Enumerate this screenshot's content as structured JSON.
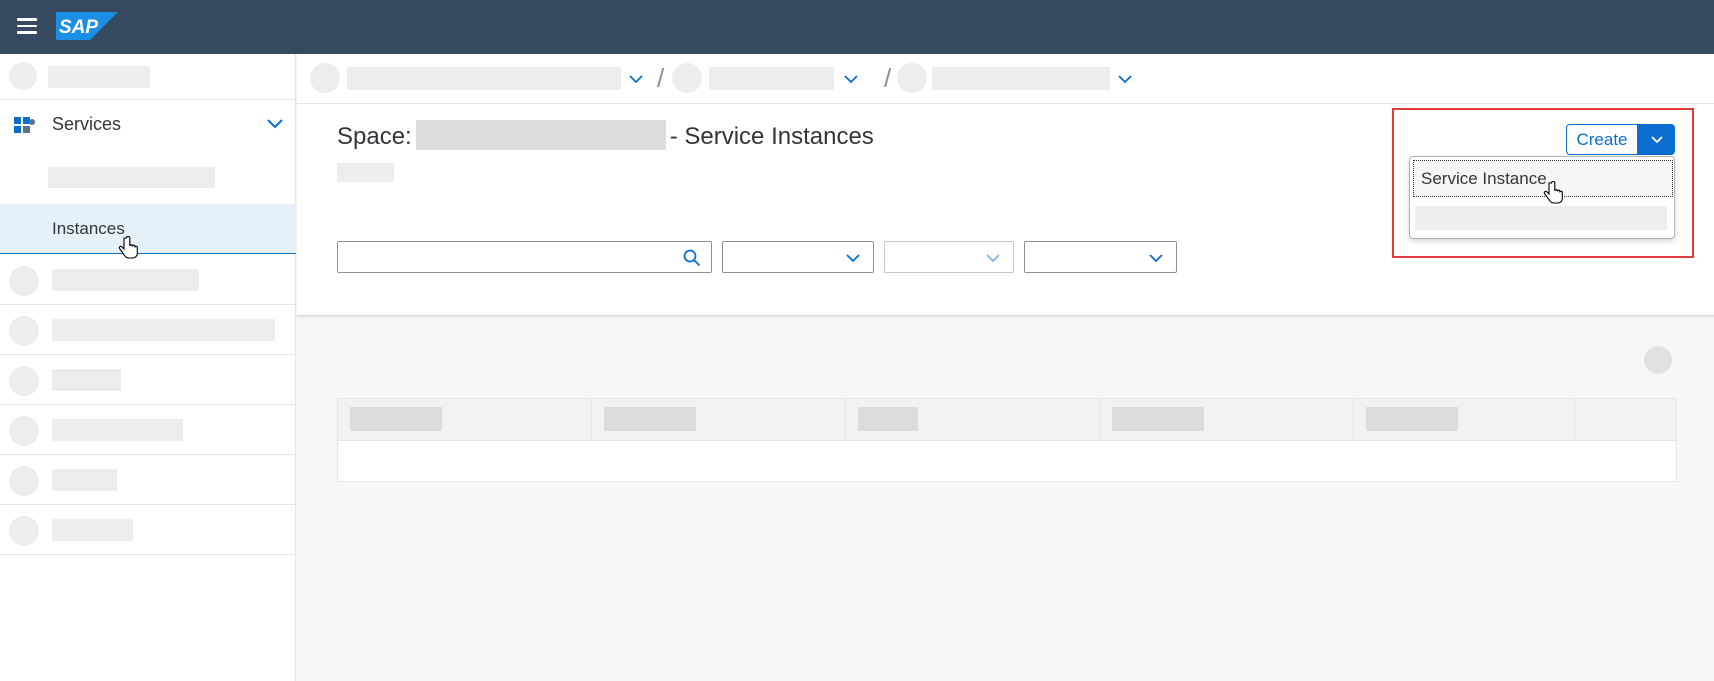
{
  "shell": {
    "logo_text": "SAP"
  },
  "sidebar": {
    "services_label": "Services",
    "instances_label": "Instances"
  },
  "page": {
    "title_prefix": "Space:",
    "title_suffix": "- Service Instances"
  },
  "toolbar": {
    "create_label": "Create"
  },
  "create_menu": {
    "item_1": "Service Instance"
  },
  "colors": {
    "shell_bg": "#354a5f",
    "accent": "#0a6ed1",
    "highlight": "#e03a3a",
    "selected_bg": "#e5f0fa"
  }
}
